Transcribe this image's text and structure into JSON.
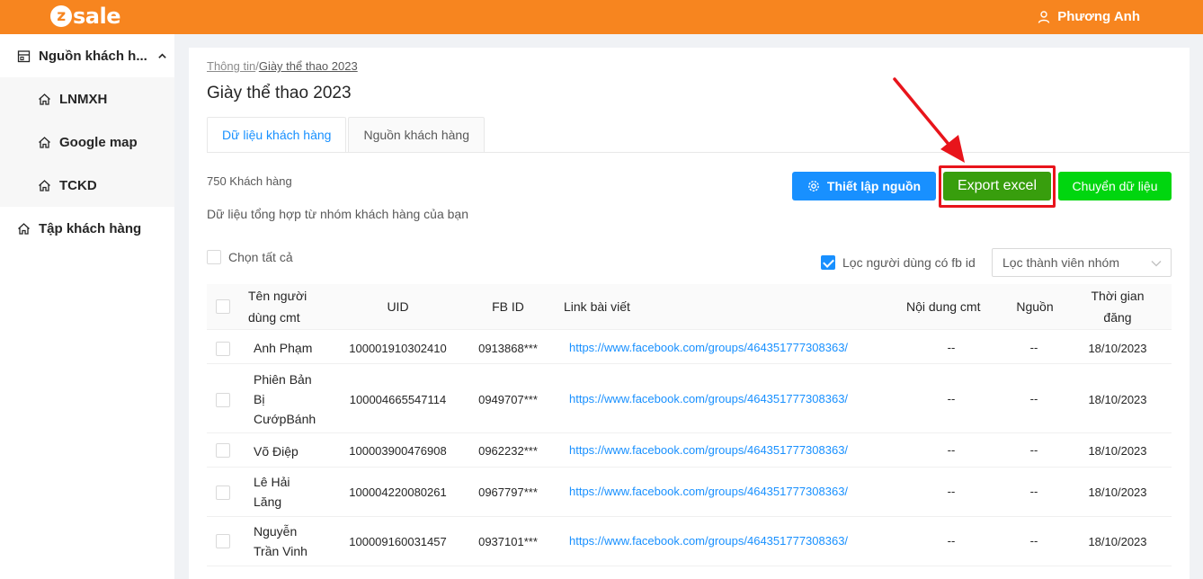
{
  "app": {
    "logo_text": "sale",
    "logo_letter": "z",
    "user_name": "Phương Anh",
    "accent": "#f7851f"
  },
  "sidebar": {
    "parent_label": "Nguồn khách h...",
    "items": [
      {
        "label": "LNMXH",
        "icon": "home-icon"
      },
      {
        "label": "Google map",
        "icon": "home-icon"
      },
      {
        "label": "TCKD",
        "icon": "home-icon"
      }
    ],
    "second_label": "Tập khách hàng"
  },
  "breadcrumb": {
    "parent": "Thông tin",
    "sep": "/",
    "current": "Giày thể thao 2023"
  },
  "page": {
    "title": "Giày thể thao 2023"
  },
  "tabs": [
    {
      "label": "Dữ liệu khách hàng",
      "active": true
    },
    {
      "label": "Nguồn khách hàng",
      "active": false
    }
  ],
  "summary": {
    "count": "750 Khách hàng",
    "description": "Dữ liệu tổng hợp từ nhóm khách hàng của bạn"
  },
  "buttons": {
    "setup": "Thiết lập nguồn",
    "export": "Export excel",
    "move": "Chuyển dữ liệu"
  },
  "filters": {
    "select_all": "Chọn tất cả",
    "fb_filter": "Lọc người dùng có fb id",
    "fb_filter_checked": true,
    "member_select": "Lọc thành viên nhóm"
  },
  "table": {
    "headers": {
      "name": "Tên người dùng cmt",
      "uid": "UID",
      "fbid": "FB ID",
      "link": "Link bài viết",
      "comment": "Nội dung cmt",
      "source": "Nguồn",
      "time": "Thời gian đăng"
    },
    "rows": [
      {
        "name": "Anh Phạm",
        "uid": "100001910302410",
        "fbid": "0913868***",
        "link": "https://www.facebook.com/groups/464351777308363/",
        "comment": "--",
        "source": "--",
        "time": "18/10/2023"
      },
      {
        "name": "Phiên Bản Bị CướpBánh",
        "uid": "100004665547114",
        "fbid": "0949707***",
        "link": "https://www.facebook.com/groups/464351777308363/",
        "comment": "--",
        "source": "--",
        "time": "18/10/2023"
      },
      {
        "name": "Võ Điệp",
        "uid": "100003900476908",
        "fbid": "0962232***",
        "link": "https://www.facebook.com/groups/464351777308363/",
        "comment": "--",
        "source": "--",
        "time": "18/10/2023"
      },
      {
        "name": "Lê Hải Lăng",
        "uid": "100004220080261",
        "fbid": "0967797***",
        "link": "https://www.facebook.com/groups/464351777308363/",
        "comment": "--",
        "source": "--",
        "time": "18/10/2023"
      },
      {
        "name": "Nguyễn Trần Vinh",
        "uid": "100009160031457",
        "fbid": "0937101***",
        "link": "https://www.facebook.com/groups/464351777308363/",
        "comment": "--",
        "source": "--",
        "time": "18/10/2023"
      }
    ]
  },
  "annotation": {
    "color": "#e8141b"
  }
}
